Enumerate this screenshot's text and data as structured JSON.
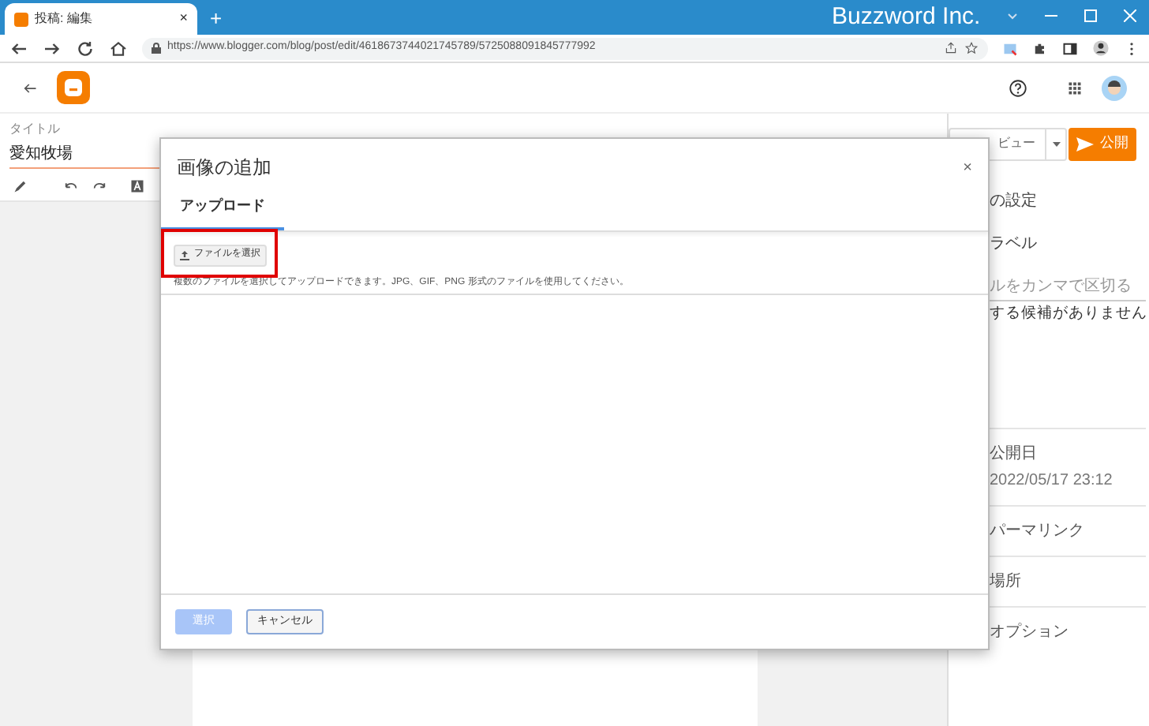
{
  "browser": {
    "tab_title": "投稿: 編集",
    "tab_close": "×",
    "new_tab": "+",
    "window_title": "Buzzword Inc.",
    "url": "https://www.blogger.com/blog/post/edit/4618673744021745789/5725088091845777992"
  },
  "editor": {
    "title_label": "タイトル",
    "title_value": "愛知牧場",
    "preview_button": "ビュー",
    "publish_button": "公開"
  },
  "sidebar": {
    "items": [
      {
        "kind": "heading",
        "text": "の設定"
      },
      {
        "kind": "heading",
        "text": "ラベル"
      },
      {
        "kind": "hint",
        "text": "ルをカンマで区切る"
      },
      {
        "kind": "plain",
        "text": "する候補がありません"
      },
      {
        "kind": "section",
        "text": "公開日",
        "sub": "2022/05/17 23:12"
      },
      {
        "kind": "section",
        "text": "パーマリンク"
      },
      {
        "kind": "section",
        "text": "場所"
      },
      {
        "kind": "section",
        "text": "オプション"
      }
    ]
  },
  "dialog": {
    "title": "画像の追加",
    "close": "×",
    "tabs": [
      {
        "label": "アップロード",
        "selected": true
      }
    ],
    "file_button": "ファイルを選択",
    "highlighted": true,
    "hint": "複数のファイルを選択してアップロードできます。JPG、GIF、PNG 形式のファイルを使用してください。",
    "buttons": [
      {
        "label": "選択",
        "disabled": true
      },
      {
        "label": "キャンセル",
        "disabled": false
      }
    ]
  }
}
